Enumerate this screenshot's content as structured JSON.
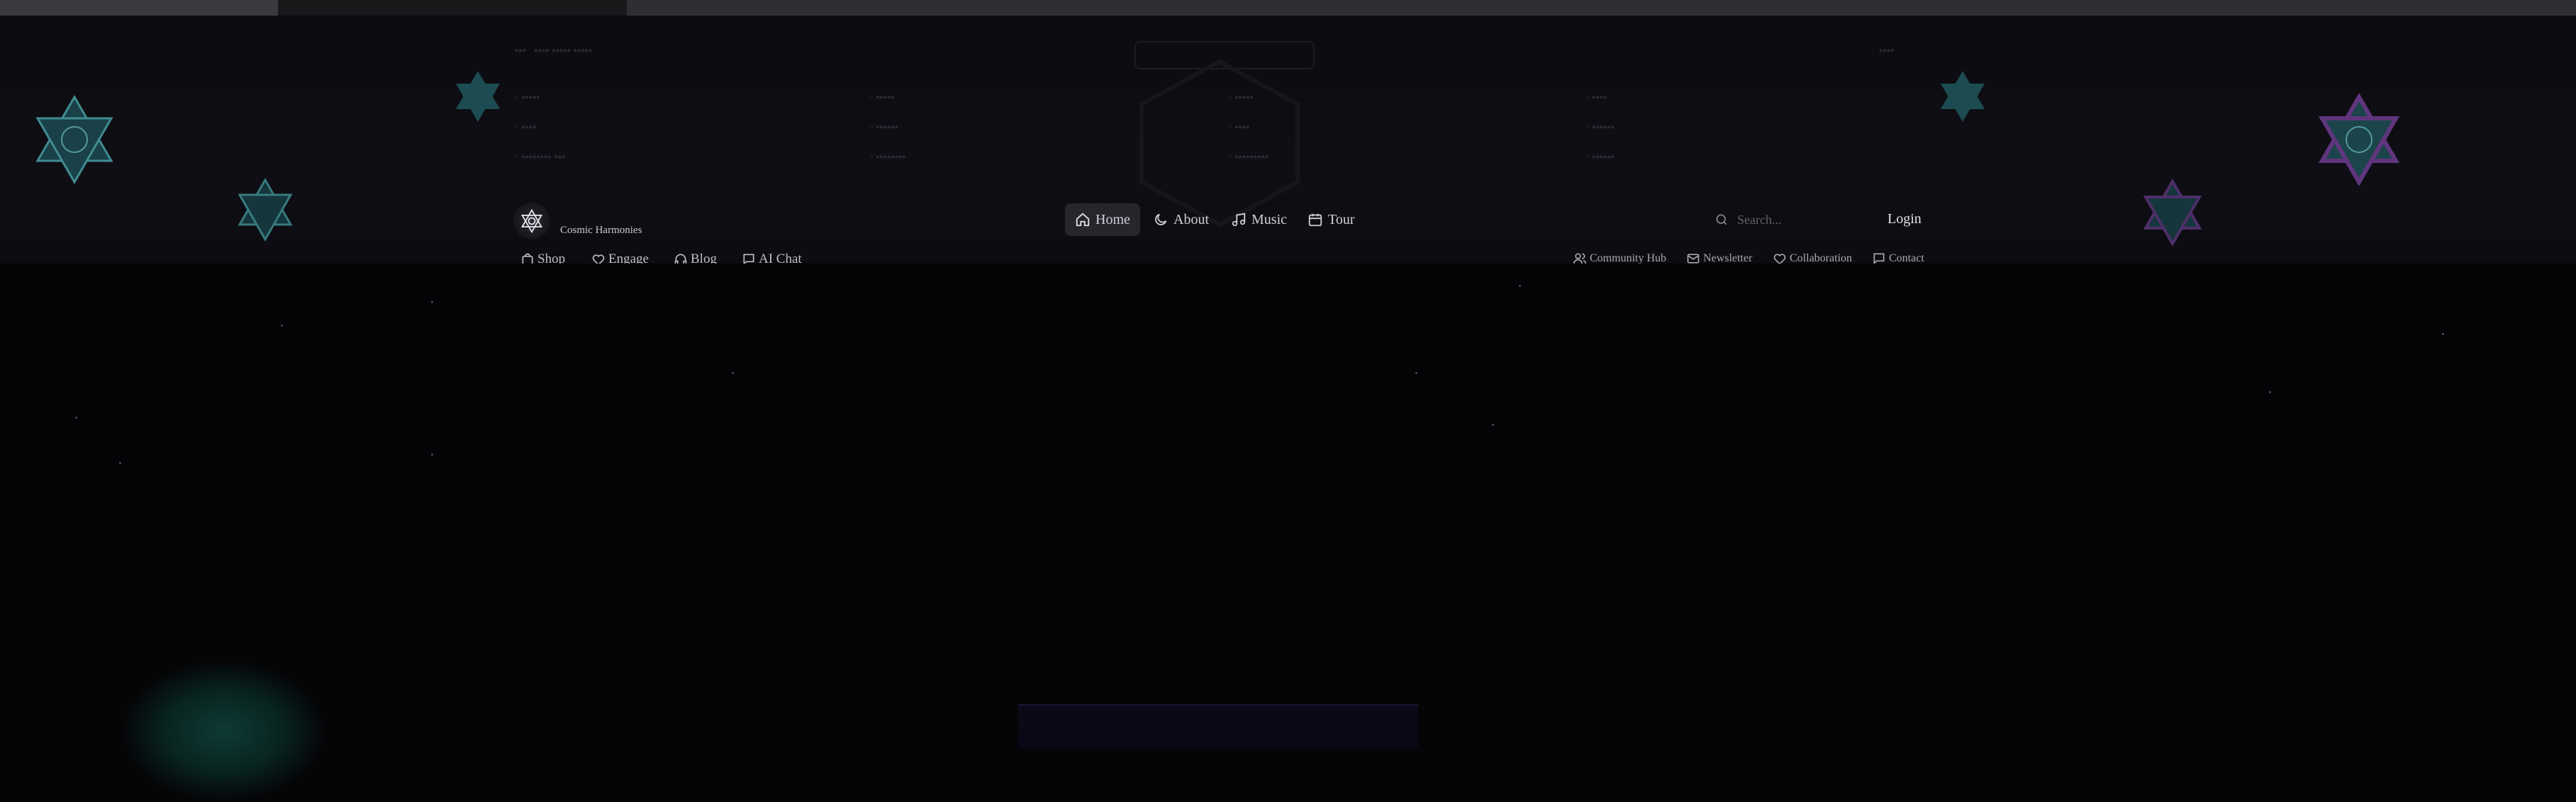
{
  "brand": {
    "name": "Cosmic Harmonies",
    "logo_icon": "star-of-david-icon"
  },
  "nav": {
    "home": "Home",
    "about": "About",
    "music": "Music",
    "tour": "Tour",
    "active": "Home"
  },
  "subnav": {
    "shop": "Shop",
    "engage": "Engage",
    "blog": "Blog",
    "ai_chat": "AI Chat",
    "community_hub": "Community Hub",
    "newsletter": "Newsletter",
    "collaboration": "Collaboration",
    "contact": "Contact"
  },
  "search": {
    "placeholder": "Search..."
  },
  "login": {
    "label": "Login"
  },
  "colors": {
    "background": "#050507",
    "star_teal": "#2f8f93",
    "star_purple": "#6a2f8a",
    "text": "#d8d8de"
  }
}
